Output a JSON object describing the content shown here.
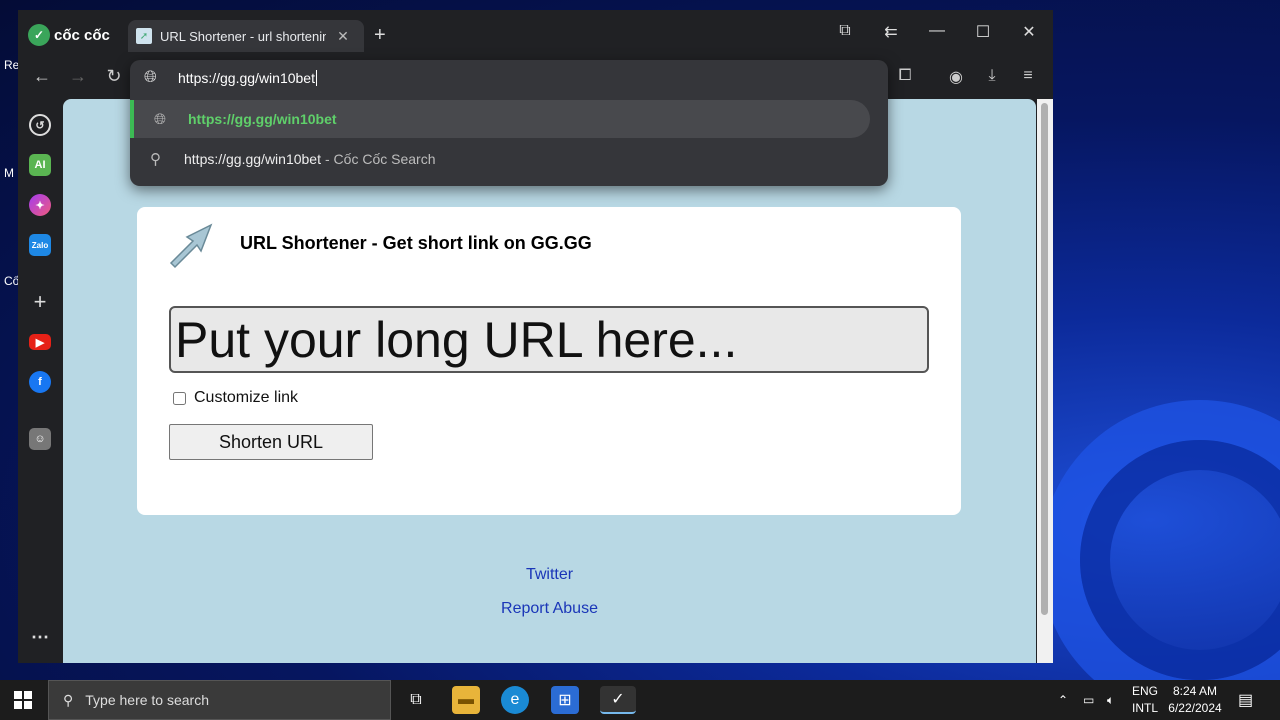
{
  "browser": {
    "brand": "cốc cốc",
    "tab_title": "URL Shortener - url shortening",
    "address": "https://gg.gg/win10bet"
  },
  "omnibox": {
    "suggestion_1": "https://gg.gg/win10bet",
    "suggestion_2_main": "https://gg.gg/win10bet",
    "suggestion_2_sub": "- Cốc Cốc Search"
  },
  "page": {
    "title": "URL Shortener - Get short link on GG.GG",
    "input_placeholder": "Put your long URL here...",
    "customize_label": "Customize link",
    "shorten_button": "Shorten URL",
    "footer_links": [
      "Twitter",
      "Report Abuse"
    ]
  },
  "sidebar": {
    "items": [
      "history-icon",
      "ai-chat-icon",
      "messenger-icon",
      "zalo-icon",
      "add-icon",
      "youtube-icon",
      "facebook-icon",
      "avatar-icon",
      "more-icon"
    ]
  },
  "taskbar": {
    "search_placeholder": "Type here to search",
    "lang_1": "ENG",
    "lang_2": "INTL",
    "time": "8:24 AM",
    "date": "6/22/2024"
  },
  "desktop": {
    "labels": [
      "Re",
      "M",
      "Cố"
    ]
  },
  "colors": {
    "accent_green": "#3cba54",
    "page_bg": "#b8d8e4",
    "link_blue": "#1a36b8"
  }
}
